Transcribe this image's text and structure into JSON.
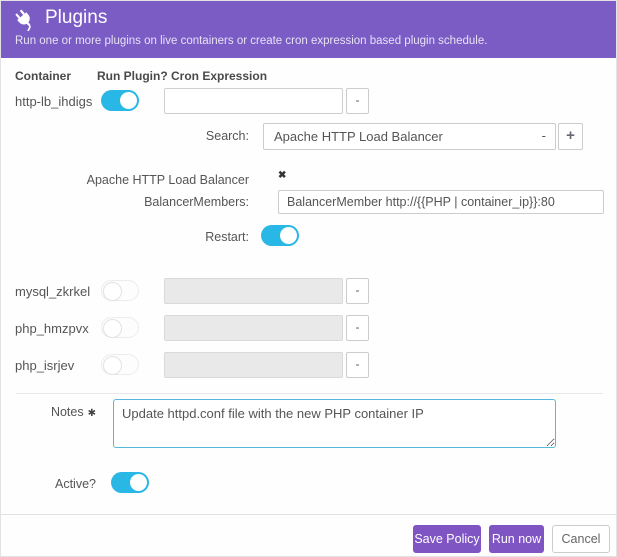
{
  "header": {
    "icon": "plug-icon",
    "title": "Plugins",
    "subtitle": "Run one or more plugins on live containers or create cron expression based plugin schedule."
  },
  "columns": {
    "container": "Container",
    "run_plugin": "Run Plugin?",
    "cron": "Cron Expression"
  },
  "rows": [
    {
      "name": "http-lb_ihdigs",
      "run_plugin": "on",
      "cron_value": ""
    },
    {
      "name": "mysql_zkrkel",
      "run_plugin": "off",
      "cron_value": ""
    },
    {
      "name": "php_hmzpvx",
      "run_plugin": "off",
      "cron_value": ""
    },
    {
      "name": "php_isrjev",
      "run_plugin": "off",
      "cron_value": ""
    }
  ],
  "dropdown_caret": "-",
  "search": {
    "label": "Search:",
    "selected": "Apache HTTP Load Balancer",
    "add_button": "+"
  },
  "plugin": {
    "name": "Apache HTTP Load Balancer",
    "remove_icon": "✖",
    "field_label": "BalancerMembers:",
    "field_value": "BalancerMember http://{{PHP | container_ip}}:80",
    "restart_label": "Restart:",
    "restart_state": "on"
  },
  "notes": {
    "label": "Notes",
    "required_marker": "✱",
    "value": "Update httpd.conf file with the new PHP container IP"
  },
  "active": {
    "label": "Active?",
    "state": "on"
  },
  "footer": {
    "save": "Save Policy",
    "run": "Run now",
    "cancel": "Cancel"
  },
  "colors": {
    "header_bg": "#7b5cc5",
    "button_purple": "#7e55c3",
    "toggle_on": "#29b7e5",
    "notes_focus_border": "#57b8dc"
  }
}
